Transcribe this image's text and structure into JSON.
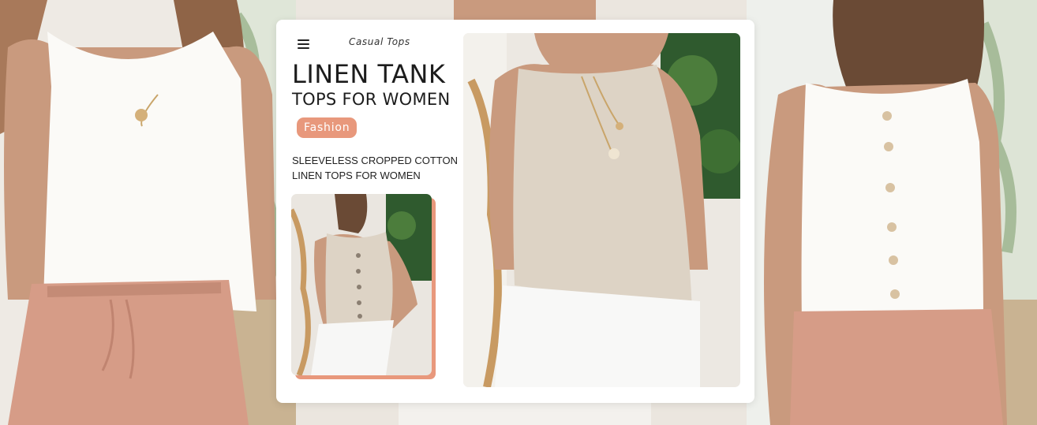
{
  "header": {
    "menu_icon": "hamburger-menu-icon",
    "category": "Casual Tops"
  },
  "hero": {
    "title_line1": "LINEN TANK",
    "title_line2": "TOPS FOR WOMEN",
    "tag": "Fashion",
    "description": "SLEEVELESS CROPPED COTTON LINEN TOPS FOR WOMEN"
  },
  "colors": {
    "accent": "#e8987c",
    "card_background": "#ffffff",
    "linen_beige": "#ddd3c5",
    "top_white": "#fbfaf7",
    "shorts_pink": "#d69c87"
  }
}
